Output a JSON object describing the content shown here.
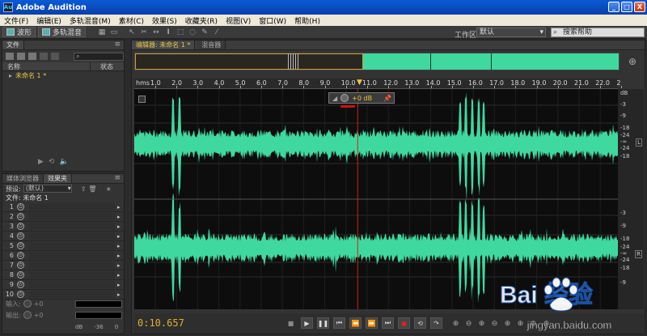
{
  "window": {
    "title": "Adobe Audition",
    "icon_text": "Au",
    "minimize": "_",
    "maximize": "□",
    "close": "X"
  },
  "menu": [
    "文件(F)",
    "编辑(E)",
    "多轨混音(M)",
    "素材(C)",
    "效果(S)",
    "收藏夹(R)",
    "视图(V)",
    "窗口(W)",
    "帮助(H)"
  ],
  "toolbar": {
    "waveform_label": "波形",
    "multitrack_label": "多轨混音",
    "workspace_label": "工作区:",
    "workspace_value": "默认",
    "search_placeholder": "搜索帮助"
  },
  "file_panel": {
    "tab_files": "文件",
    "col_name": "名称",
    "col_status": "状态",
    "item": "未命名 1 *"
  },
  "effects_panel": {
    "tab_media": "媒体浏览器",
    "tab_effects": "效果夹",
    "preset_label": "预设:",
    "preset_value": "(默认)",
    "file_label": "文件: 未命名 1",
    "rack_numbers": [
      "1",
      "2",
      "3",
      "4",
      "5",
      "6",
      "7",
      "8",
      "9",
      "10"
    ],
    "input_label": "输入:",
    "output_label": "输出:",
    "input_value": "+0",
    "output_value": "+0",
    "scale": [
      "dB",
      "-36",
      "0"
    ]
  },
  "editor": {
    "tab_editor": "编辑器: 未命名 1 *",
    "tab_mixer": "混音器",
    "time_unit": "hms",
    "time_ticks": [
      "1.0",
      "2.0",
      "3.0",
      "4.0",
      "5.0",
      "6.0",
      "7.0",
      "8.0",
      "9.0",
      "10.0",
      "11.0",
      "12.0",
      "13.0",
      "14.0",
      "15.0",
      "16.0",
      "17.0",
      "18.0",
      "19.0",
      "20.0",
      "21.0",
      "22.0",
      "2"
    ],
    "hud_gain": "+0 dB",
    "db_unit": "dB",
    "db_ticks_top": [
      "-3",
      "-9",
      "-18",
      "-24",
      "-∞",
      "-24",
      "-18"
    ],
    "db_ticks_bottom": [
      "-3",
      "-9",
      "-18",
      "-24",
      "-∞",
      "-24",
      "-18",
      "-9"
    ],
    "channel_l": "L",
    "channel_r": "R",
    "playhead_fraction": 0.462,
    "timecode": "0:10.657"
  },
  "colors": {
    "waveform": "#3fd9a0",
    "playhead": "#cc2222",
    "timecode": "#e0b030",
    "file_item": "#e6c84a"
  },
  "watermark": {
    "text": "Bai 经验",
    "url": "jingyan.baidu.com"
  }
}
